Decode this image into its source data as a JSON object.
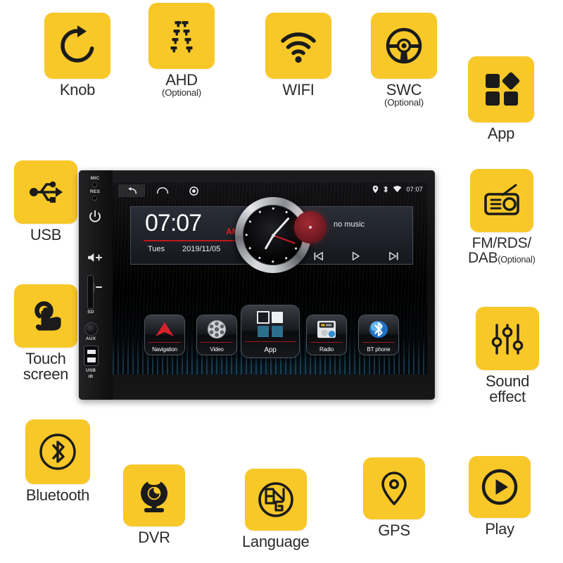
{
  "features": [
    {
      "key": "knob",
      "icon": "rotate-knob-icon",
      "label": "Knob",
      "optional": null
    },
    {
      "key": "ahd",
      "icon": "parking-guide-lines-icon",
      "label": "AHD",
      "optional": "(Optional)"
    },
    {
      "key": "wifi",
      "icon": "wifi-icon",
      "label": "WIFI",
      "optional": null
    },
    {
      "key": "swc",
      "icon": "steering-wheel-icon",
      "label": "SWC",
      "optional": "(Optional)"
    },
    {
      "key": "app",
      "icon": "app-grid-icon",
      "label": "App",
      "optional": null
    },
    {
      "key": "usb",
      "icon": "usb-icon",
      "label": "USB",
      "optional": null
    },
    {
      "key": "touch",
      "icon": "touch-hand-icon",
      "label": "Touch",
      "label2": "screen",
      "optional": null
    },
    {
      "key": "fmradio",
      "icon": "radio-icon",
      "label": "FM/RDS/",
      "label2": "DAB",
      "optional": "(Optional)"
    },
    {
      "key": "sound",
      "icon": "equalizer-sliders-icon",
      "label": "Sound",
      "label2": "effect",
      "optional": null
    },
    {
      "key": "bluetooth",
      "icon": "bluetooth-icon",
      "label": "Bluetooth",
      "optional": null
    },
    {
      "key": "dvr",
      "icon": "dvr-camera-icon",
      "label": "DVR",
      "optional": null
    },
    {
      "key": "language",
      "icon": "language-eng-icon",
      "label": "Language",
      "optional": null
    },
    {
      "key": "gps",
      "icon": "gps-pin-icon",
      "label": "GPS",
      "optional": null
    },
    {
      "key": "play",
      "icon": "play-circle-icon",
      "label": "Play",
      "optional": null
    }
  ],
  "colors": {
    "tile_yellow": "#f8c828",
    "icon_black": "#1b1b1b",
    "label_gray": "#2b2b2b",
    "accent_red": "#c0181b",
    "screen_blue": "#46aad2"
  },
  "device": {
    "side_panel": {
      "mic_label": "MIC",
      "res_label": "RES",
      "power_icon": "power-icon",
      "volume_up": "+",
      "volume_down": "−",
      "volume_up_icon": "speaker-plus-icon",
      "volume_down_icon": "speaker-minus-icon",
      "sd_label": "SD",
      "aux_label": "AUX",
      "usb_label": "USB",
      "ir_label": "IR"
    },
    "statusbar": {
      "back_icon": "back-arrow-icon",
      "home_icon": "home-icon",
      "recent_icon": "recent-apps-icon",
      "gps_icon": "gps-pin-icon",
      "bluetooth_icon": "bluetooth-icon",
      "wifi_icon": "wifi-icon",
      "clock": "07:07"
    },
    "widget": {
      "time": "07:07",
      "meridiem": "AM",
      "weekday": "Tues",
      "date": "2019/11/05",
      "analog_clock_icon": "analog-clock-icon",
      "music_status": "no music",
      "vinyl_icon": "vinyl-disc-icon",
      "prev_icon": "skip-previous-icon",
      "play_icon": "play-icon",
      "next_icon": "skip-next-icon"
    },
    "dock": [
      {
        "key": "navigation",
        "label": "Navigation",
        "icon": "navigation-arrow-icon"
      },
      {
        "key": "video",
        "label": "Video",
        "icon": "film-reel-icon"
      },
      {
        "key": "app",
        "label": "App",
        "icon": "app-grid-icon"
      },
      {
        "key": "radio",
        "label": "Radio",
        "icon": "radio-tuner-icon"
      },
      {
        "key": "btphone",
        "label": "BT phone",
        "icon": "bluetooth-phone-icon"
      }
    ]
  }
}
